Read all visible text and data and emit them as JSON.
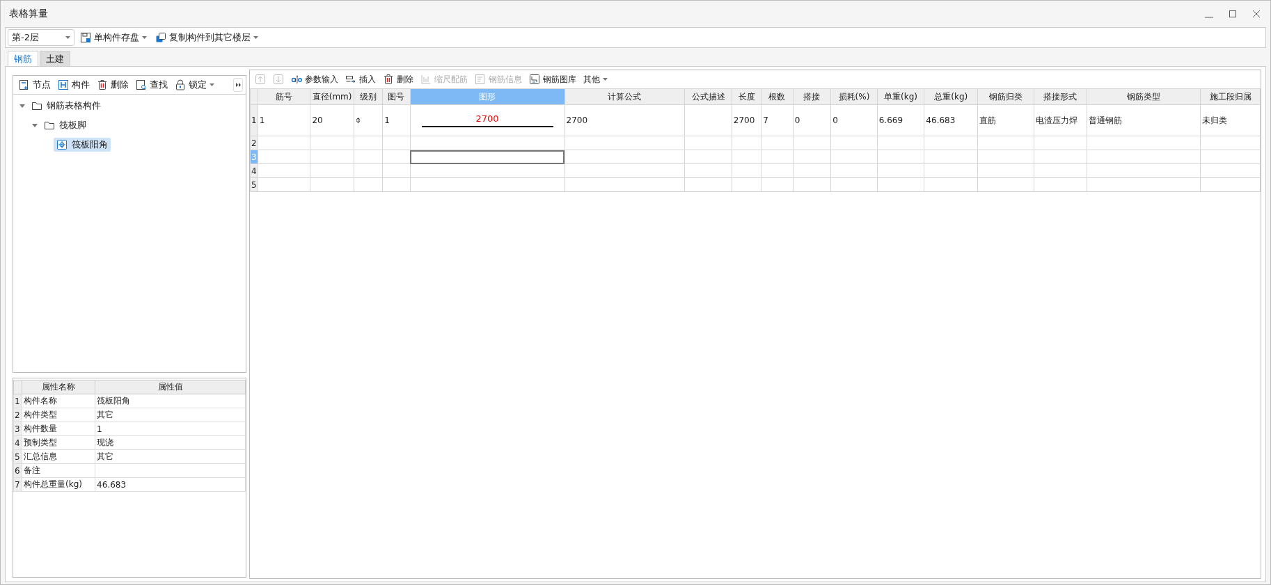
{
  "window": {
    "title": "表格算量"
  },
  "toolbar": {
    "floor": "第-2层",
    "buttons": [
      {
        "label": "单构件存盘",
        "kind": "save"
      },
      {
        "label": "复制构件到其它楼层",
        "kind": "copy"
      }
    ]
  },
  "tabs": [
    {
      "label": "钢筋",
      "selected": true
    },
    {
      "label": "土建",
      "selected": false
    }
  ],
  "tree_toolbar": [
    {
      "label": "节点",
      "kind": "node"
    },
    {
      "label": "构件",
      "kind": "part"
    },
    {
      "label": "删除",
      "kind": "delete"
    },
    {
      "label": "查找",
      "kind": "find"
    },
    {
      "label": "锁定",
      "kind": "lock"
    }
  ],
  "tree": [
    {
      "label": "钢筋表格构件",
      "kind": "folder",
      "expanded": true,
      "selected": false,
      "children": [
        {
          "label": "筏板脚",
          "kind": "folder",
          "expanded": true,
          "selected": false,
          "children": [
            {
              "label": "筏板阳角",
              "kind": "part",
              "selected": true
            }
          ]
        }
      ]
    }
  ],
  "properties": {
    "columns": [
      "属性名称",
      "属性值"
    ],
    "rows": [
      {
        "number": "1",
        "name": "构件名称",
        "value": "筏板阳角"
      },
      {
        "number": "2",
        "name": "构件类型",
        "value": "其它"
      },
      {
        "number": "3",
        "name": "构件数量",
        "value": "1"
      },
      {
        "number": "4",
        "name": "预制类型",
        "value": "现浇"
      },
      {
        "number": "5",
        "name": "汇总信息",
        "value": "其它"
      },
      {
        "number": "6",
        "name": "备注"
      },
      {
        "number": "7",
        "name": "构件总重量(kg)",
        "value": "46.683"
      }
    ]
  },
  "grid_toolbar": [
    {
      "kind": "up",
      "disabled": true
    },
    {
      "kind": "down",
      "disabled": true
    },
    {
      "label": "参数输入",
      "kind": "param",
      "disabled": false
    },
    {
      "label": "插入",
      "kind": "insert",
      "disabled": false
    },
    {
      "label": "删除",
      "kind": "delete",
      "disabled": false
    },
    {
      "label": "缩尺配筋",
      "kind": "scale",
      "disabled": true
    },
    {
      "label": "钢筋信息",
      "kind": "info",
      "disabled": true
    },
    {
      "label": "钢筋图库",
      "kind": "library",
      "disabled": false
    },
    {
      "label": "其他",
      "kind": "more",
      "disabled": false
    }
  ],
  "grid": {
    "columns": [
      {
        "label": "筋号",
        "selected": false
      },
      {
        "label": "直径(mm)",
        "selected": false
      },
      {
        "label": "级别",
        "selected": false
      },
      {
        "label": "图号",
        "selected": false
      },
      {
        "label": "图形",
        "selected": true
      },
      {
        "label": "计算公式",
        "selected": false
      },
      {
        "label": "公式描述",
        "selected": false
      },
      {
        "label": "长度",
        "selected": false
      },
      {
        "label": "根数",
        "selected": false
      },
      {
        "label": "搭接",
        "selected": false
      },
      {
        "label": "损耗(%)",
        "selected": false
      },
      {
        "label": "单重(kg)",
        "selected": false
      },
      {
        "label": "总重(kg)",
        "selected": false
      },
      {
        "label": "钢筋归类",
        "selected": false
      },
      {
        "label": "搭接形式",
        "selected": false
      },
      {
        "label": "钢筋类型",
        "selected": false
      },
      {
        "label": "施工段归属",
        "selected": false
      }
    ],
    "rows": [
      {
        "number": "1",
        "selected": false,
        "cells": [
          "1",
          "20",
          "⌽",
          "1",
          {
            "kind": "shape",
            "text": "2700"
          },
          "2700",
          null,
          "2700",
          "7",
          "0",
          "0",
          "6.669",
          "46.683",
          "直筋",
          "电渣压力焊",
          "普通钢筋",
          "未归类"
        ]
      },
      {
        "number": "2",
        "selected": false
      },
      {
        "number": "3",
        "selected": true
      },
      {
        "number": "4",
        "selected": false
      },
      {
        "number": "5",
        "selected": false
      }
    ]
  }
}
